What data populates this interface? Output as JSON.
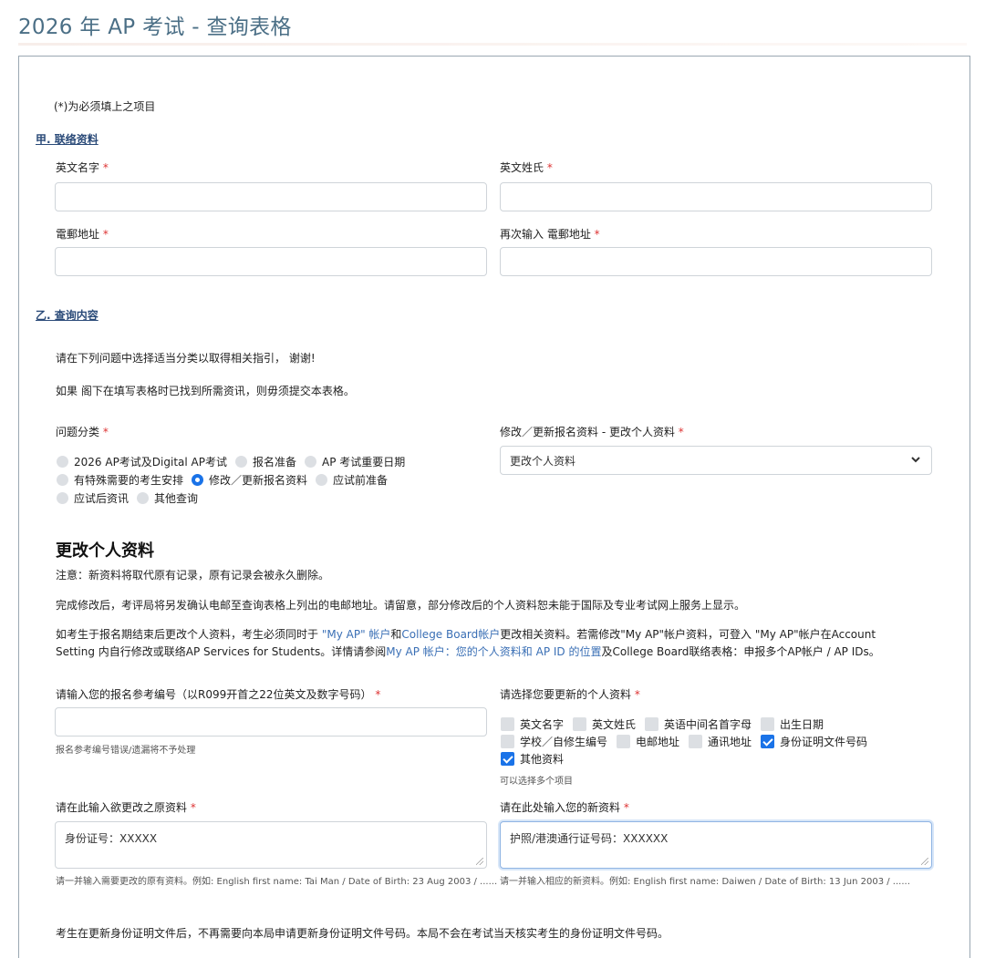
{
  "page": {
    "title": "2026 年 AP 考试 - 查询表格"
  },
  "form": {
    "required_note": "(*)为必须填上之项目",
    "section_a": {
      "heading": "甲. 联络资料",
      "first_name_label": "英文名字",
      "last_name_label": "英文姓氏",
      "email_label": "電郵地址",
      "email_confirm_label": "再次输入 電郵地址",
      "required_mark": "*"
    },
    "section_b": {
      "heading": "乙. 查询内容",
      "intro_1": "请在下列问题中选择适当分类以取得相关指引， 谢谢!",
      "intro_2": "如果 阁下在填写表格时已找到所需资讯，则毋须提交本表格。",
      "category_label": "问题分类",
      "categories": [
        {
          "label": "2026 AP考试及Digital AP考试",
          "selected": false
        },
        {
          "label": "报名准备",
          "selected": false
        },
        {
          "label": "AP 考试重要日期",
          "selected": false
        },
        {
          "label": "有特殊需要的考生安排",
          "selected": false
        },
        {
          "label": "修改／更新报名资料",
          "selected": true
        },
        {
          "label": "应试前准备",
          "selected": false
        },
        {
          "label": "应试后资讯",
          "selected": false
        },
        {
          "label": "其他查询",
          "selected": false
        }
      ],
      "subcategory_label": "修改／更新报名资料 - 更改个人资料",
      "subcategory_value": "更改个人资料"
    },
    "change_info": {
      "heading": "更改个人资料",
      "note": "注意：新资料将取代原有记录，原有记录会被永久删除。",
      "para_1": "完成修改后，考评局将另发确认电邮至查询表格上列出的电邮地址。请留意，部分修改后的个人资料恕未能于国际及专业考试网上服务上显示。",
      "para_2_line1_a": "如考生于报名期结束后更改个人资料，考生必须同时于 ",
      "para_2_line1_link1": "\"My AP\" 帐户",
      "para_2_line1_b": "和",
      "para_2_line1_link2": "College Board帐户",
      "para_2_line1_c": "更改相关资料。若需修改\"My AP\"帐户资料，可登入 \"My AP\"帐户在Account",
      "para_2_line2_a": "Setting 内自行修改或联络AP Services for Students。详情请参阅",
      "para_2_line2_link": "My AP 帐户：您的个人资料和 AP ID 的位置",
      "para_2_line2_b": "及College Board联络表格：申报多个AP帐户 / AP IDs。",
      "ref_label": "请输入您的报名参考编号（以R099开首之22位英文及数字号码）",
      "ref_hint": "报名参考编号错误/遗漏将不予处理",
      "select_label": "请选择您要更新的个人资料",
      "fields": [
        {
          "label": "英文名字",
          "checked": false
        },
        {
          "label": "英文姓氏",
          "checked": false
        },
        {
          "label": "英语中间名首字母",
          "checked": false
        },
        {
          "label": "出生日期",
          "checked": false
        },
        {
          "label": "学校／自修生编号",
          "checked": false
        },
        {
          "label": "电邮地址",
          "checked": false
        },
        {
          "label": "通讯地址",
          "checked": false
        },
        {
          "label": "身份证明文件号码",
          "checked": true
        },
        {
          "label": "其他资料",
          "checked": true
        }
      ],
      "multi_hint": "可以选择多个项目",
      "original_label": "请在此输入欲更改之原资料",
      "original_value": "身份证号：XXXXX",
      "original_hint": "请一并输入需要更改的原有资料。例如: English first name: Tai Man / Date of Birth: 23 Aug 2003 / ......",
      "new_label": "请在此处输入您的新资料",
      "new_value": "护照/港澳通行证号码：XXXXXX",
      "new_hint": "请一并输入相应的新资料。例如: English first name: Daiwen / Date of Birth: 13 Jun 2003 / ......",
      "footer_note": "考生在更新身份证明文件后，不再需要向本局申请更新身份证明文件号码。本局不会在考试当天核实考生的身份证明文件号码。"
    }
  }
}
